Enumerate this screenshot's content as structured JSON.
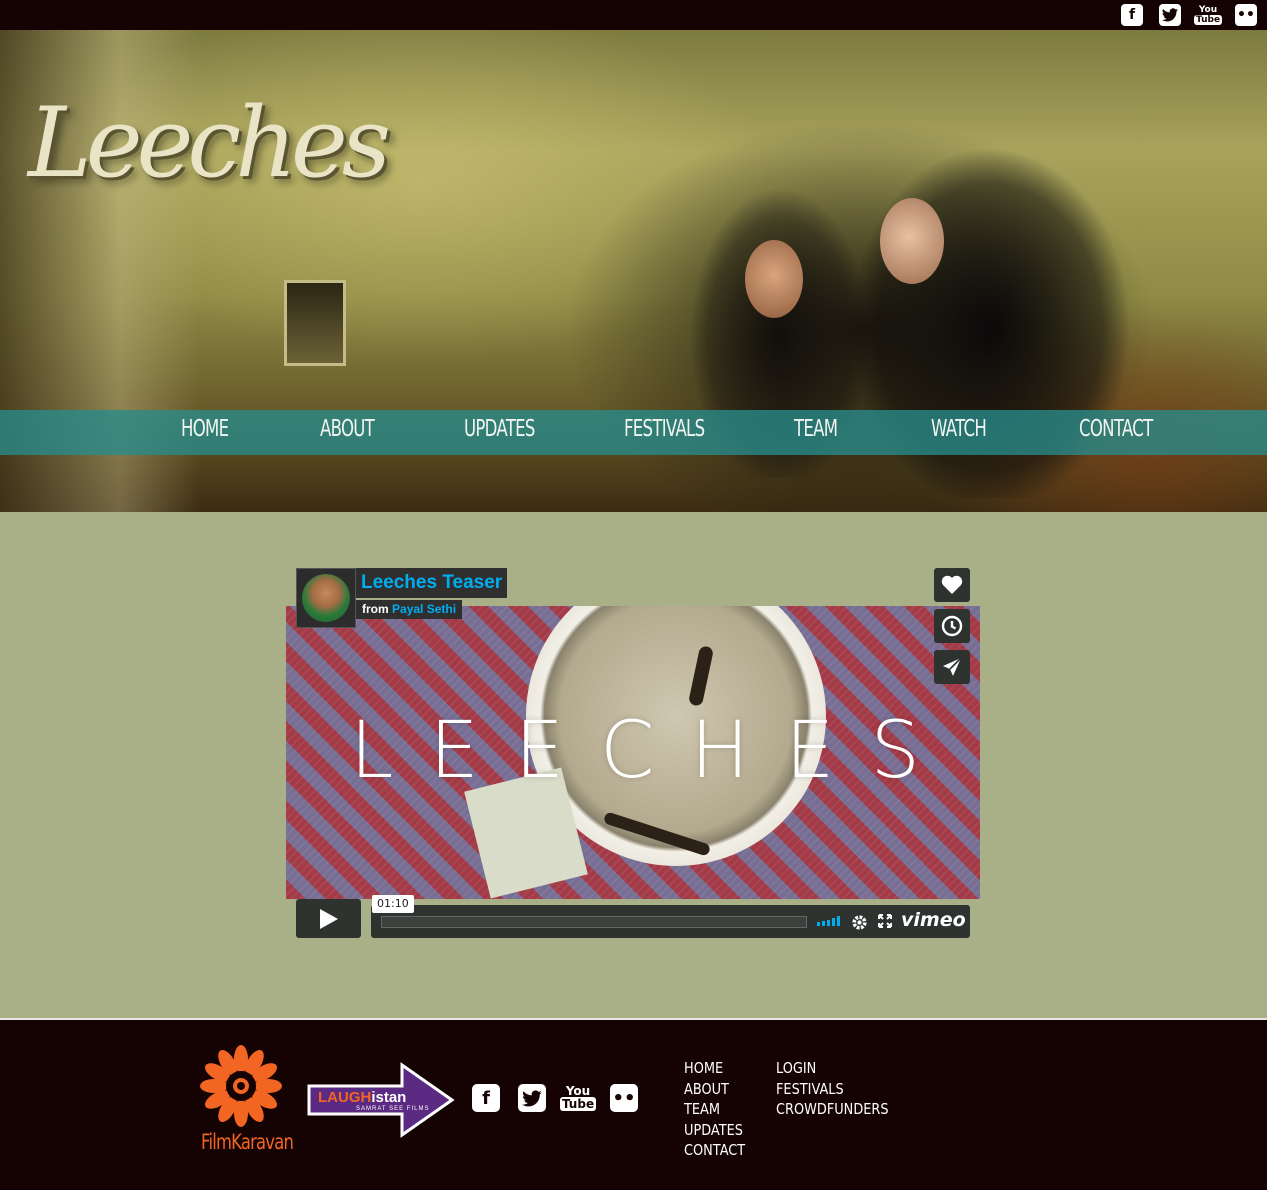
{
  "social_top": [
    {
      "icon": "facebook-icon",
      "glyph": "f"
    },
    {
      "icon": "twitter-icon",
      "glyph": "t"
    },
    {
      "icon": "youtube-icon",
      "you": "You",
      "tube": "Tube"
    },
    {
      "icon": "flickr-icon",
      "glyph": "••"
    }
  ],
  "hero": {
    "logo_text": "Leeches",
    "nav": [
      "HOME",
      "ABOUT",
      "UPDATES",
      "FESTIVALS",
      "TEAM",
      "WATCH",
      "CONTACT"
    ]
  },
  "video": {
    "title": "Leeches Teaser",
    "from_label": "from",
    "author": "Payal Sethi",
    "frame_text": "LEECHES",
    "time": "01:10",
    "brand": "vimeo",
    "side_buttons": [
      "heart-icon",
      "clock-icon",
      "send-icon"
    ],
    "colors": {
      "accent": "#00adef",
      "control_bg": "#2f3330"
    }
  },
  "footer": {
    "filmkaravan": "FilmKaravan",
    "laughistan": {
      "part1": "LAUGH",
      "part2": "istan",
      "sub": "SAMRAT SEE FILMS"
    },
    "social": [
      {
        "icon": "facebook-icon",
        "glyph": "f"
      },
      {
        "icon": "twitter-icon",
        "glyph": "t"
      },
      {
        "icon": "youtube-icon",
        "you": "You",
        "tube": "Tube"
      },
      {
        "icon": "flickr-icon",
        "glyph": "••"
      }
    ],
    "links_col1": [
      "HOME",
      "ABOUT",
      "TEAM",
      "UPDATES",
      "CONTACT"
    ],
    "links_col2": [
      "LOGIN",
      "FESTIVALS",
      "CROWDFUNDERS"
    ],
    "colors": {
      "brand_orange": "#f26522",
      "bg": "#150303"
    }
  }
}
